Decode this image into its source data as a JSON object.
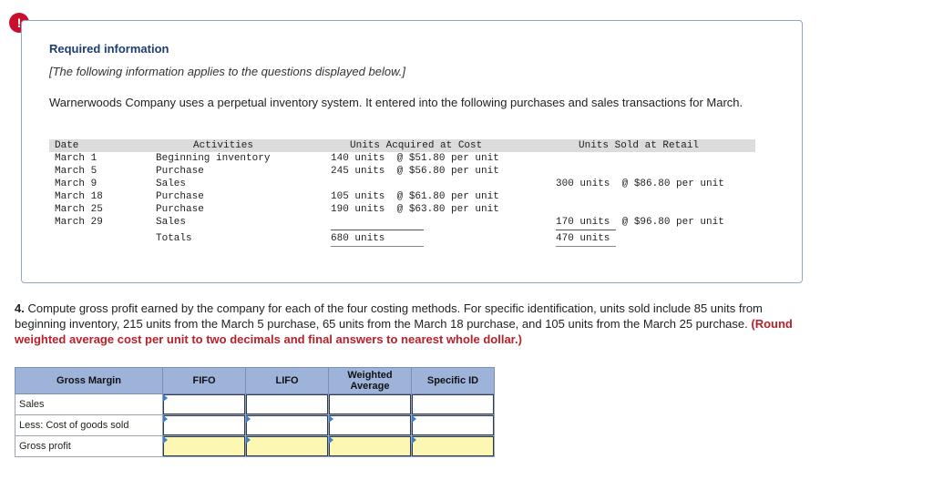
{
  "alert": {
    "symbol": "!"
  },
  "info": {
    "title": "Required information",
    "subtitle": "[The following information applies to the questions displayed below.]",
    "paragraph": "Warnerwoods Company uses a perpetual inventory system. It entered into the following purchases and sales transactions for March."
  },
  "inventory": {
    "headers": {
      "date": "Date",
      "activities": "Activities",
      "acquired": "Units Acquired at Cost",
      "sold": "Units Sold at Retail"
    },
    "rows": [
      {
        "date": "March 1",
        "activity": "Beginning inventory",
        "acquired": "140 units  @ $51.80 per unit",
        "sold": ""
      },
      {
        "date": "March 5",
        "activity": "Purchase",
        "acquired": "245 units  @ $56.80 per unit",
        "sold": ""
      },
      {
        "date": "March 9",
        "activity": "Sales",
        "acquired": "",
        "sold": "300 units  @ $86.80 per unit"
      },
      {
        "date": "March 18",
        "activity": "Purchase",
        "acquired": "105 units  @ $61.80 per unit",
        "sold": ""
      },
      {
        "date": "March 25",
        "activity": "Purchase",
        "acquired": "190 units  @ $63.80 per unit",
        "sold": ""
      },
      {
        "date": "March 29",
        "activity": "Sales",
        "acquired": "",
        "sold": "170 units  @ $96.80 per unit"
      }
    ],
    "totals": {
      "label": "Totals",
      "acquired": "680 units",
      "sold": "470 units"
    }
  },
  "question": {
    "number": "4.",
    "text": " Compute gross profit earned by the company for each of the four costing methods. For specific identification, units sold include 85 units from beginning inventory, 215 units from the March 5 purchase, 65 units from the March 18 purchase, and 105 units from the March 25 purchase. ",
    "instruction": "(Round weighted average cost per unit to two decimals and final answers to nearest whole dollar.)"
  },
  "gross_margin_table": {
    "headers": {
      "label": "Gross Margin",
      "fifo": "FIFO",
      "lifo": "LIFO",
      "weighted": "Weighted Average",
      "specific": "Specific ID"
    },
    "rows": [
      {
        "label": "Sales"
      },
      {
        "label": "Less: Cost of goods sold"
      },
      {
        "label": "Gross profit"
      }
    ]
  },
  "colors": {
    "alert": "#c8102e",
    "title": "#1f3d72",
    "instruction": "#b8202a",
    "header_bg": "#9db3d9",
    "answer_yellow": "#fdf7b4"
  }
}
